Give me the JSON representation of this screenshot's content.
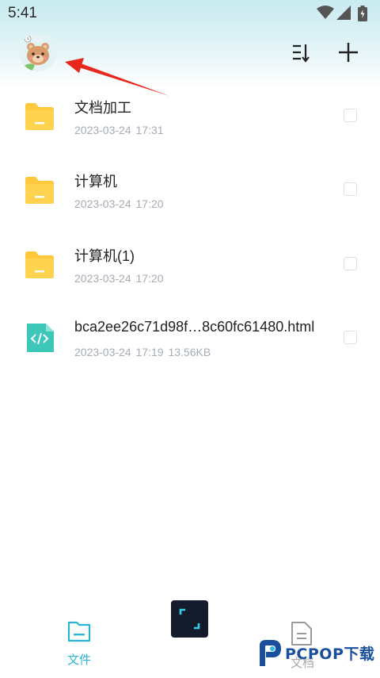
{
  "status_bar": {
    "time": "5:41"
  },
  "toolbar": {
    "avatar": "bear-avatar",
    "sort_icon": "sort-icon",
    "add_icon": "plus-icon"
  },
  "files": [
    {
      "name": "文档加工",
      "date": "2023-03-24",
      "time": "17:31",
      "size": "",
      "type": "folder"
    },
    {
      "name": "计算机",
      "date": "2023-03-24",
      "time": "17:20",
      "size": "",
      "type": "folder"
    },
    {
      "name": "计算机(1)",
      "date": "2023-03-24",
      "time": "17:20",
      "size": "",
      "type": "folder"
    },
    {
      "name": "bca2ee26c71d98f…8c60fc61480.html",
      "date": "2023-03-24",
      "time": "17:19",
      "size": "13.56KB",
      "type": "html"
    }
  ],
  "bottom_nav": {
    "files_label": "文件",
    "docs_label": "文档"
  },
  "watermark": {
    "brand": "PCPOP下载"
  },
  "colors": {
    "accent": "#2bb3d8",
    "folder": "#ffc83d",
    "html_icon": "#3cc7b8",
    "arrow": "#e8271d"
  }
}
